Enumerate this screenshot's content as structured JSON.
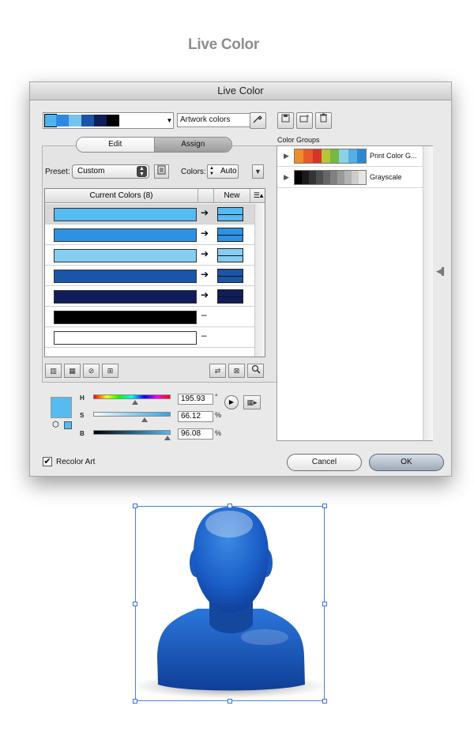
{
  "page": {
    "title": "Live Color"
  },
  "dialog": {
    "title": "Live Color",
    "swatch_strip": [
      "#4fb4ee",
      "#2e8ae0",
      "#74c3ef",
      "#1d53a6",
      "#0e1e57",
      "#000000",
      "#ffffff"
    ],
    "artwork_field": "Artwork colors",
    "tabs": {
      "edit": "Edit",
      "assign": "Assign"
    },
    "preset": {
      "label": "Preset:",
      "value": "Custom"
    },
    "colors": {
      "label": "Colors:",
      "value": "Auto"
    },
    "table": {
      "header_current": "Current Colors (8)",
      "header_new": "New",
      "rows": [
        {
          "current": "#55bbf0",
          "new": "#55bbf0",
          "mapped": true,
          "selected": true
        },
        {
          "current": "#2e92e4",
          "new": "#2e92e4",
          "mapped": true,
          "selected": false
        },
        {
          "current": "#86cdf2",
          "new": "#86cdf2",
          "mapped": true,
          "selected": false
        },
        {
          "current": "#1a55a8",
          "new": "#1a55a8",
          "mapped": true,
          "selected": false
        },
        {
          "current": "#0f1d5a",
          "new": "#0f1d5a",
          "mapped": true,
          "selected": false
        },
        {
          "current": "#000000",
          "new": "",
          "mapped": false,
          "selected": false
        },
        {
          "current": "#ffffff",
          "new": "",
          "mapped": false,
          "selected": false
        }
      ]
    },
    "hsb": {
      "h": {
        "label": "H",
        "value": "195.93",
        "unit": "°",
        "fraction": 0.544
      },
      "s": {
        "label": "S",
        "value": "66.12",
        "unit": "%",
        "fraction": 0.661
      },
      "b": {
        "label": "B",
        "value": "96.08",
        "unit": "%",
        "fraction": 0.961
      },
      "current_color": "#55bbf0"
    },
    "color_groups": {
      "label": "Color Groups",
      "groups": [
        {
          "name": "Print Color G...",
          "colors": [
            "#f08c2c",
            "#e9592a",
            "#d6332b",
            "#b7c537",
            "#76b843",
            "#8ad3e6",
            "#56aee3",
            "#2e88d1"
          ]
        },
        {
          "name": "Grayscale",
          "colors": [
            "#000000",
            "#1a1a1a",
            "#333333",
            "#4d4d4d",
            "#666666",
            "#808080",
            "#999999",
            "#b3b3b3",
            "#cccccc",
            "#e6e6e6"
          ]
        }
      ]
    },
    "recolor_art": {
      "label": "Recolor Art",
      "checked": true
    },
    "buttons": {
      "cancel": "Cancel",
      "ok": "OK"
    }
  }
}
